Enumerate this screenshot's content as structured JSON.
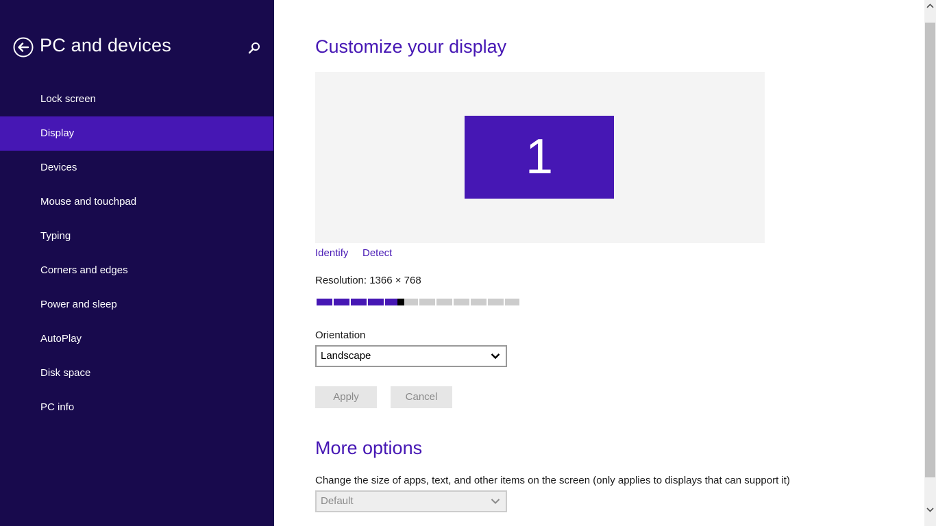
{
  "app": {
    "title": "PC and devices",
    "back_icon": "back-arrow-icon",
    "search_icon": "search-icon"
  },
  "sidebar": {
    "items": [
      {
        "label": "Lock screen",
        "active": false
      },
      {
        "label": "Display",
        "active": true
      },
      {
        "label": "Devices",
        "active": false
      },
      {
        "label": "Mouse and touchpad",
        "active": false
      },
      {
        "label": "Typing",
        "active": false
      },
      {
        "label": "Corners and edges",
        "active": false
      },
      {
        "label": "Power and sleep",
        "active": false
      },
      {
        "label": "AutoPlay",
        "active": false
      },
      {
        "label": "Disk space",
        "active": false
      },
      {
        "label": "PC info",
        "active": false
      }
    ]
  },
  "display": {
    "heading": "Customize your display",
    "monitor_number": "1",
    "identify_label": "Identify",
    "detect_label": "Detect",
    "resolution_text": "Resolution: 1366 × 768",
    "resolution_slider": {
      "steps": 12,
      "selected_step": 5
    },
    "orientation_label": "Orientation",
    "orientation_value": "Landscape",
    "apply_label": "Apply",
    "cancel_label": "Cancel"
  },
  "more_options": {
    "heading": "More options",
    "size_description": "Change the size of apps, text, and other items on the screen (only applies to displays that can support it)",
    "size_value": "Default"
  },
  "colors": {
    "sidebar_bg": "#180a4d",
    "accent": "#4617b4",
    "display_bg": "#f4f4f4"
  }
}
